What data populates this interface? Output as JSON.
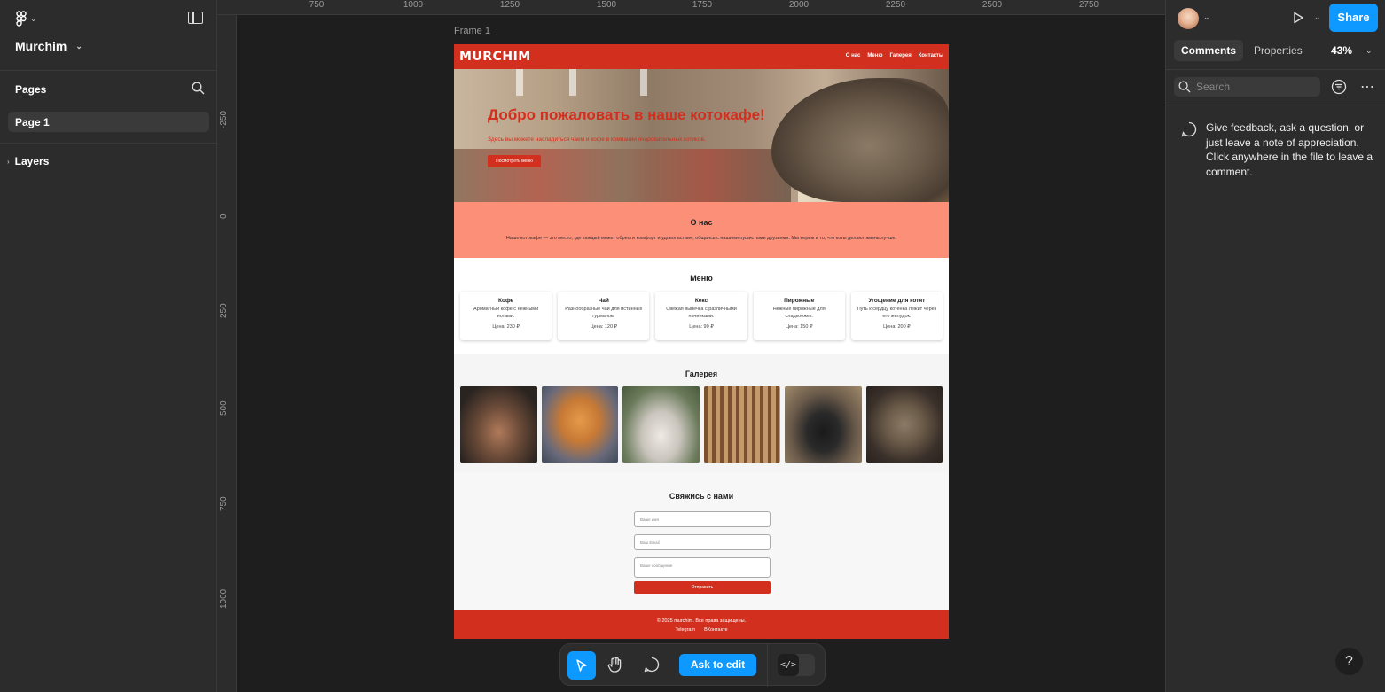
{
  "app": {
    "file_name": "Murchim",
    "pages_label": "Pages",
    "page_name": "Page 1",
    "layers_label": "Layers",
    "frame_label": "Frame 1"
  },
  "ruler": {
    "top_ticks": [
      "750",
      "1000",
      "1250",
      "1500",
      "1750",
      "2000",
      "2250",
      "2500",
      "2750"
    ],
    "left_ticks": [
      "-250",
      "0",
      "250",
      "500",
      "750",
      "1000"
    ]
  },
  "site": {
    "logo": "MURCHIM",
    "nav": [
      "О нас",
      "Меню",
      "Галерея",
      "Контакты"
    ],
    "hero_title": "Добро пожаловать в наше котокафе!",
    "hero_subtitle": "Здесь вы можете насладиться чаем и кофе в компании очаровательных котиков.",
    "hero_button": "Посмотреть меню",
    "about_title": "О нас",
    "about_text": "Наше котокафе — это место, где каждый может обрести комфорт и удовольствие, общаясь с нашими пушистыми друзьями. Мы верим в то, что коты делают жизнь лучше.",
    "menu_title": "Меню",
    "menu_items": [
      {
        "title": "Кофе",
        "desc": "Ароматный кофе с нежными нотами.",
        "price": "Цена: 230 ₽"
      },
      {
        "title": "Чай",
        "desc": "Разнообразные чаи для истинных гурманов.",
        "price": "Цена: 120 ₽"
      },
      {
        "title": "Кекс",
        "desc": "Свежая выпечка с различными начинками.",
        "price": "Цена: 90 ₽"
      },
      {
        "title": "Пирожные",
        "desc": "Нежные пирожные для сладкоежек.",
        "price": "Цена: 150 ₽"
      },
      {
        "title": "Угощение для котят",
        "desc": "Путь к сердцу котенка лежит через его желудок.",
        "price": "Цена: 200 ₽"
      }
    ],
    "gallery_title": "Галерея",
    "contact_title": "Свяжись с нами",
    "name_placeholder": "Ваше имя",
    "email_placeholder": "Ваш Email",
    "message_placeholder": "Ваше сообщение",
    "send_button": "Отправить",
    "footer_copy": "© 2025 murchim. Все права защищены.",
    "footer_links": [
      "Telegram",
      "ВКонтакте"
    ]
  },
  "toolbar": {
    "ask_label": "Ask to edit",
    "code_label": "</>"
  },
  "right_panel": {
    "share_label": "Share",
    "tabs": [
      "Comments",
      "Properties"
    ],
    "zoom": "43%",
    "search_placeholder": "Search",
    "hint": "Give feedback, ask a question, or just leave a note of appreciation. Click anywhere in the file to leave a comment.",
    "help": "?"
  },
  "colors": {
    "accent": "#0d99ff",
    "brand_red": "#d32f1e",
    "about_bg": "#fb8f78"
  }
}
